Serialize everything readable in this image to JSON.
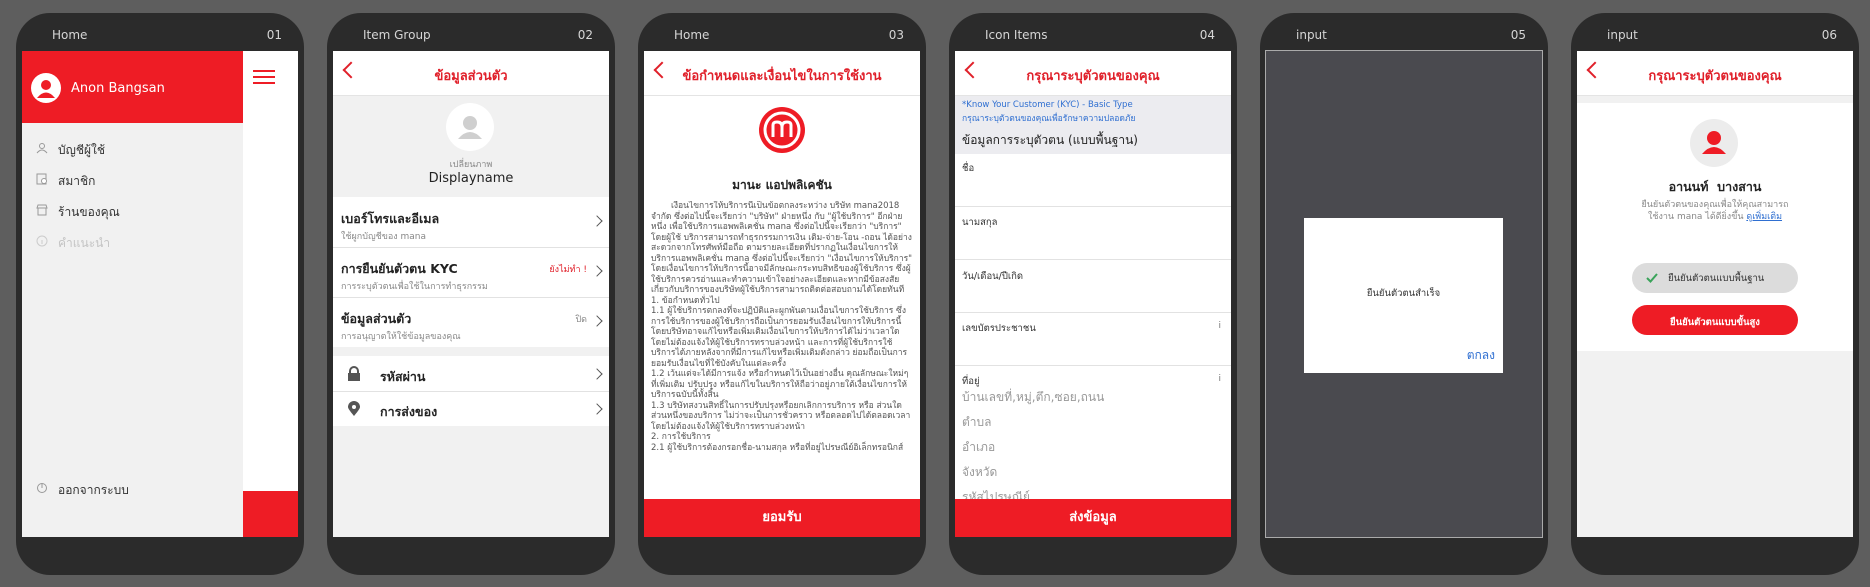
{
  "accent": "#ee1c25",
  "phones": [
    {
      "label": "Home",
      "num": "01"
    },
    {
      "label": "Item Group",
      "num": "02"
    },
    {
      "label": "Home",
      "num": "03"
    },
    {
      "label": "Icon Items",
      "num": "04"
    },
    {
      "label": "input",
      "num": "05"
    },
    {
      "label": "input",
      "num": "06"
    }
  ],
  "s1": {
    "user_name": "Anon Bangsan",
    "menu": [
      "บัญชีผู้ใช้",
      "สมาชิก",
      "ร้านของคุณ",
      "คำแนะนำ"
    ],
    "logout": "ออกจากระบบ"
  },
  "s2": {
    "title": "ข้อมูลส่วนตัว",
    "change_photo": "เปลี่ยนภาพ",
    "display_name": "Displayname",
    "rows": [
      {
        "title": "เบอร์โทรและอีเมล",
        "sub": "ใช้ผูกบัญชีของ mana",
        "status": ""
      },
      {
        "title": "การยืนยันตัวตน KYC",
        "sub": "การระบุตัวตนเพื่อใช้ในการทำธุรกรรม",
        "status": "ยังไม่ทำ !"
      },
      {
        "title": "ข้อมูลส่วนตัว",
        "sub": "การอนุญาตให้ใช้ข้อมูลของคุณ",
        "status": "ปิด"
      }
    ],
    "rows2": [
      {
        "title": "รหัสผ่าน",
        "icon": "lock-icon"
      },
      {
        "title": "การส่งของ",
        "icon": "location-pin-icon"
      }
    ]
  },
  "s3": {
    "title": "ข้อกำหนดและเงื่อนไขในการใช้งาน",
    "app_name": "มานะ แอปพลิเคชัน",
    "body": [
      "เงื่อนไขการให้บริการนี้เป็นข้อตกลงระหว่าง บริษัท mana2018 จำกัด ซึ่งต่อไปนี้จะเรียกว่า \"บริษัท\" ฝ่ายหนึ่ง กับ \"ผู้ใช้บริการ\" อีกฝ่ายหนึ่ง เพื่อใช้บริการแอพพลิเคชั่น mana ซึ่งต่อไปนี้จะเรียกว่า \"บริการ\" โดยผู้ใช้ บริการสามารถทำธุรกรรมการเงิน เติม-จ่าย-โอน -ถอน ได้อย่างสะดวกจากโทรศัพท์มือถือ ตามรายละเอียดที่ปรากฏในเงื่อนไขการให้บริการแอพพลิเคชั่น mana ซึ่งต่อไปนี้จะเรียกว่า \"เงื่อนไขการให้บริการ\" โดยเงื่อนไขการให้บริการนี้อาจมีลักษณะกระทบสิทธิของผู้ใช้บริการ ซึ่งผู้ใช้บริการควรอ่านและทำความเข้าใจอย่างละเอียดและหากมีข้อสงสัยเกี่ยวกับบริการของบริษัทผู้ใช้บริการสามารถติดต่อสอบถามได้โดยทันที",
      "1. ข้อกำหนดทั่วไป",
      "1.1 ผู้ใช้บริการตกลงที่จะปฏิบัติและผูกพันตามเงื่อนไขการใช้บริการ ซึ่งการใช้บริการของผู้ใช้บริการถือเป็นการยอมรับเงื่อนไขการให้บริการนี้ โดยบริษัทอาจแก้ไขหรือเพิ่มเติมเงื่อนไขการให้บริการได้ไม่ว่าเวลาใดโดยไม่ต้องแจ้งให้ผู้ใช้บริการทราบล่วงหน้า และการที่ผู้ใช้บริการใช้บริการได้ภายหลังจากที่มีการแก้ไขหรือเพิ่มเติมดังกล่าว ย่อมถือเป็นการยอมรับเงื่อนไขที่ใช้บังคับในแต่ละครั้ง",
      "1.2 เว้นแต่จะได้มีการแจ้ง หรือกำหนดไว้เป็นอย่างอื่น คุณลักษณะใหม่ๆ ที่เพิ่มเติม ปรับปรุง หรือแก้ไขในบริการให้ถือว่าอยู่ภายใต้เงื่อนไขการให้บริการฉบับนี้ทั้งสิ้น",
      "1.3 บริษัทสงวนสิทธิ์ในการปรับปรุงหรือยกเลิกการบริการ หรือ ส่วนใดส่วนหนึ่งของบริการ ไม่ว่าจะเป็นการชั่วคราว หรือตลอดไปได้ตลอดเวลาโดยไม่ต้องแจ้งให้ผู้ใช้บริการทราบล่วงหน้า",
      "2. การใช้บริการ",
      "2.1 ผู้ใช้บริการต้องกรอกชื่อ-นามสกุล หรือที่อยู่ไปรษณีย์อิเล็กทรอนิกส์"
    ],
    "accept": "ยอมรับ"
  },
  "s4": {
    "title": "กรุณาระบุตัวตนของคุณ",
    "kyc_line1": "*Know Your Customer (KYC) - Basic Type",
    "kyc_line2": "กรุณาระบุตัวตนของคุณเพื่อรักษาความปลอดภัย",
    "section": "ข้อมูลการระบุตัวตน (แบบพื้นฐาน)",
    "fields": [
      "ชื่อ",
      "นามสกุล",
      "วัน/เดือน/ปีเกิด",
      "เลขบัตรประชาชน"
    ],
    "address_label": "ที่อยู่",
    "address_placeholders": [
      "บ้านเลขที่,หมู่,ตึก,ซอย,ถนน",
      "ตำบล",
      "อำเภอ",
      "จังหวัด",
      "รหัสไปรษณีย์"
    ],
    "submit": "ส่งข้อมูล"
  },
  "s5": {
    "dialog_text": "ยืนยันตัวตนสำเร็จ",
    "ok": "ตกลง"
  },
  "s6": {
    "title": "กรุณาระบุตัวตนของคุณ",
    "name": "อานนท์  บางสาน",
    "desc_line1": "ยืนยันตัวตนของคุณเพื่อให้คุณสามารถ",
    "desc_line2": "ใช้งาน mana ได้ดียิ่งขึ้น",
    "more_link": "ดูเพิ่มเติม",
    "basic_button": "ยืนยันตัวตนแบบพื้นฐาน",
    "advanced_button": "ยืนยันตัวตนแบบขั้นสูง"
  }
}
